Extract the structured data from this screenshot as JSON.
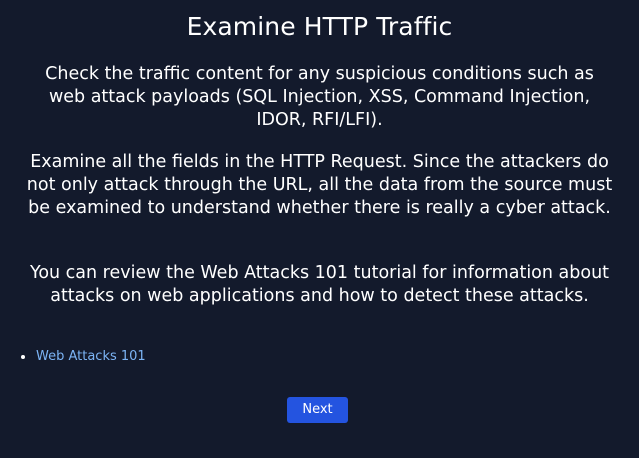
{
  "page": {
    "title": "Examine HTTP Traffic",
    "paragraphs": [
      "Check the traffic content for any suspicious conditions such as web attack payloads (SQL Injection, XSS, Command Injection, IDOR, RFI/LFI).",
      "Examine all the fields in the HTTP Request. Since the attackers do not only attack through the URL, all the data from the source must be examined to understand whether there is really a cyber attack.",
      "You can review the Web Attacks 101 tutorial for information about attacks on web applications and how to detect these attacks."
    ],
    "links": [
      {
        "label": "Web Attacks 101"
      }
    ],
    "next_label": "Next"
  },
  "colors": {
    "background": "#131a2c",
    "text": "#ffffff",
    "link": "#7cb4f5",
    "button": "#2454e0"
  }
}
